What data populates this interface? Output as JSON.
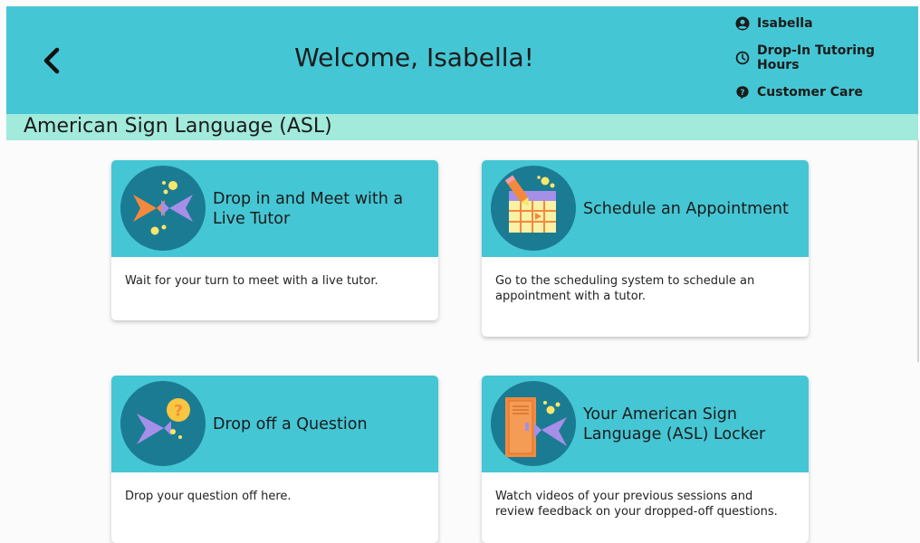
{
  "header": {
    "title": "Welcome, Isabella!",
    "back_icon": "chevron-left-icon",
    "color": "#45c6d4"
  },
  "user_menu": [
    {
      "label": "Isabella",
      "icon": "user-circle-icon"
    },
    {
      "label": "Drop-In Tutoring Hours",
      "icon": "clock-icon"
    },
    {
      "label": "Customer Care",
      "icon": "help-bubble-icon"
    }
  ],
  "subheader": {
    "title": "American Sign Language (ASL)",
    "color": "#a1eadc"
  },
  "cards": [
    {
      "title": "Drop in and Meet with a Live Tutor",
      "description": "Wait for your turn to meet with a live tutor.",
      "icon": "fish-meeting-icon"
    },
    {
      "title": "Schedule an Appointment",
      "description": "Go to the scheduling system to schedule an appointment with a tutor.",
      "icon": "calendar-icon"
    },
    {
      "title": "Drop off a Question",
      "description": "Drop your question off here.",
      "icon": "fish-question-icon"
    },
    {
      "title": "Your American Sign Language (ASL) Locker",
      "description": "Watch videos of your previous sessions and review feedback on your dropped-off questions.",
      "icon": "locker-icon"
    }
  ]
}
